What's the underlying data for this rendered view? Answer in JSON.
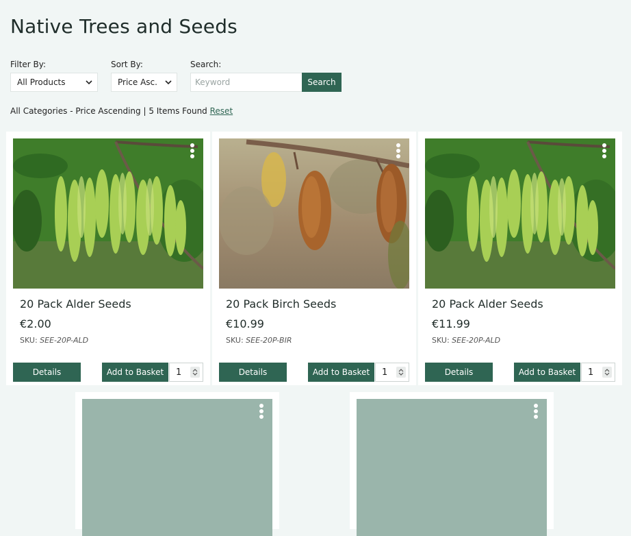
{
  "page": {
    "title": "Native Trees and Seeds"
  },
  "filters": {
    "filter_by": {
      "label": "Filter By:",
      "value": "All Products"
    },
    "sort_by": {
      "label": "Sort By:",
      "value": "Price Asc."
    },
    "search": {
      "label": "Search:",
      "placeholder": "Keyword",
      "button": "Search"
    }
  },
  "summary": {
    "text": "All Categories - Price Ascending | 5 Items Found",
    "reset": "Reset"
  },
  "products": [
    {
      "name": "20 Pack Alder Seeds",
      "price": "€2.00",
      "sku_label": "SKU:",
      "sku": "SEE-20P-ALD",
      "details": "Details",
      "add": "Add to Basket",
      "qty": "1"
    },
    {
      "name": "20 Pack Birch Seeds",
      "price": "€10.99",
      "sku_label": "SKU:",
      "sku": "SEE-20P-BIR",
      "details": "Details",
      "add": "Add to Basket",
      "qty": "1"
    },
    {
      "name": "20 Pack Alder Seeds",
      "price": "€11.99",
      "sku_label": "SKU:",
      "sku": "SEE-20P-ALD",
      "details": "Details",
      "add": "Add to Basket",
      "qty": "1"
    }
  ],
  "colors": {
    "accent": "#2f6553",
    "background": "#f1f6f5",
    "placeholder": "#9ab5ab"
  },
  "icons": {
    "menu": "kebab-menu-icon",
    "select": "chevron-down-icon",
    "stepper": "stepper-arrows-icon"
  }
}
